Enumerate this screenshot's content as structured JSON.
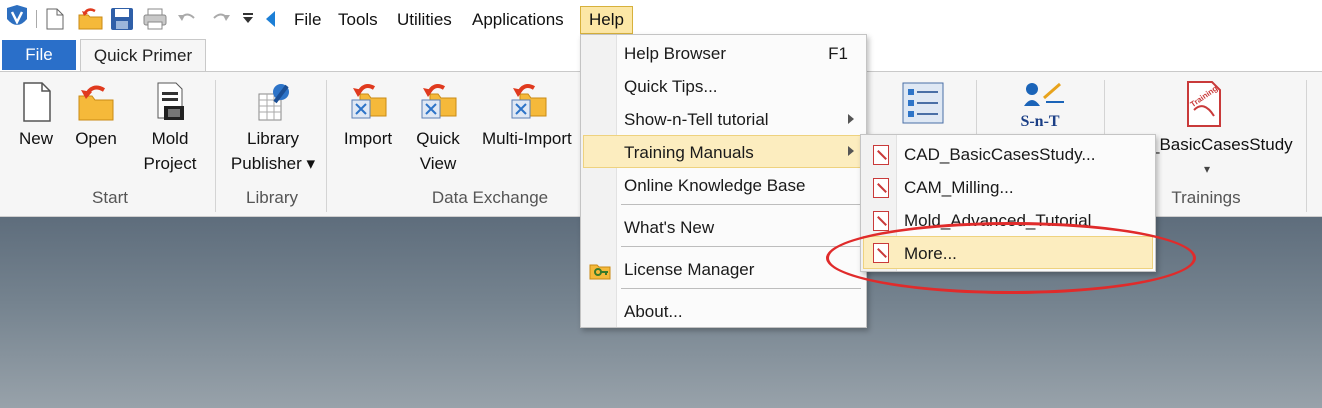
{
  "menubar": {
    "items": [
      {
        "label": "File"
      },
      {
        "label": "Tools"
      },
      {
        "label": "Utilities"
      },
      {
        "label": "Applications"
      },
      {
        "label": "Help"
      }
    ]
  },
  "tabs": {
    "file": "File",
    "quick_primer": "Quick Primer"
  },
  "ribbon": {
    "groups": {
      "start": "Start",
      "library": "Library",
      "data_exchange": "Data Exchange",
      "trainings": "Trainings"
    },
    "buttons": {
      "new": "New",
      "open": "Open",
      "mold_project_1": "Mold",
      "mold_project_2": "Project",
      "library_publisher_1": "Library",
      "library_publisher_2": "Publisher ▾",
      "import": "Import",
      "quick_view_1": "Quick",
      "quick_view_2": "View",
      "multi_import": "Multi-Import",
      "training_case": "_BasicCasesStudy",
      "training_dropdown": "▾",
      "snt_badge": "S-n-T",
      "training_badge": "Training"
    }
  },
  "help_menu": {
    "items": [
      {
        "label": "Help Browser",
        "shortcut": "F1"
      },
      {
        "label": "Quick Tips..."
      },
      {
        "label": "Show-n-Tell tutorial"
      },
      {
        "label": "Training Manuals"
      },
      {
        "label": "Online Knowledge Base"
      },
      {
        "label": "What's New"
      },
      {
        "label": "License Manager"
      },
      {
        "label": "About..."
      }
    ]
  },
  "training_submenu": {
    "items": [
      {
        "label": "CAD_BasicCasesStudy..."
      },
      {
        "label": "CAM_Milling..."
      },
      {
        "label": "Mold_Advanced_Tutorial"
      },
      {
        "label": "More..."
      }
    ]
  },
  "colors": {
    "file_tab": "#2a6fc9",
    "menu_highlight": "#fcedbf",
    "annotation": "#e02b2b"
  }
}
